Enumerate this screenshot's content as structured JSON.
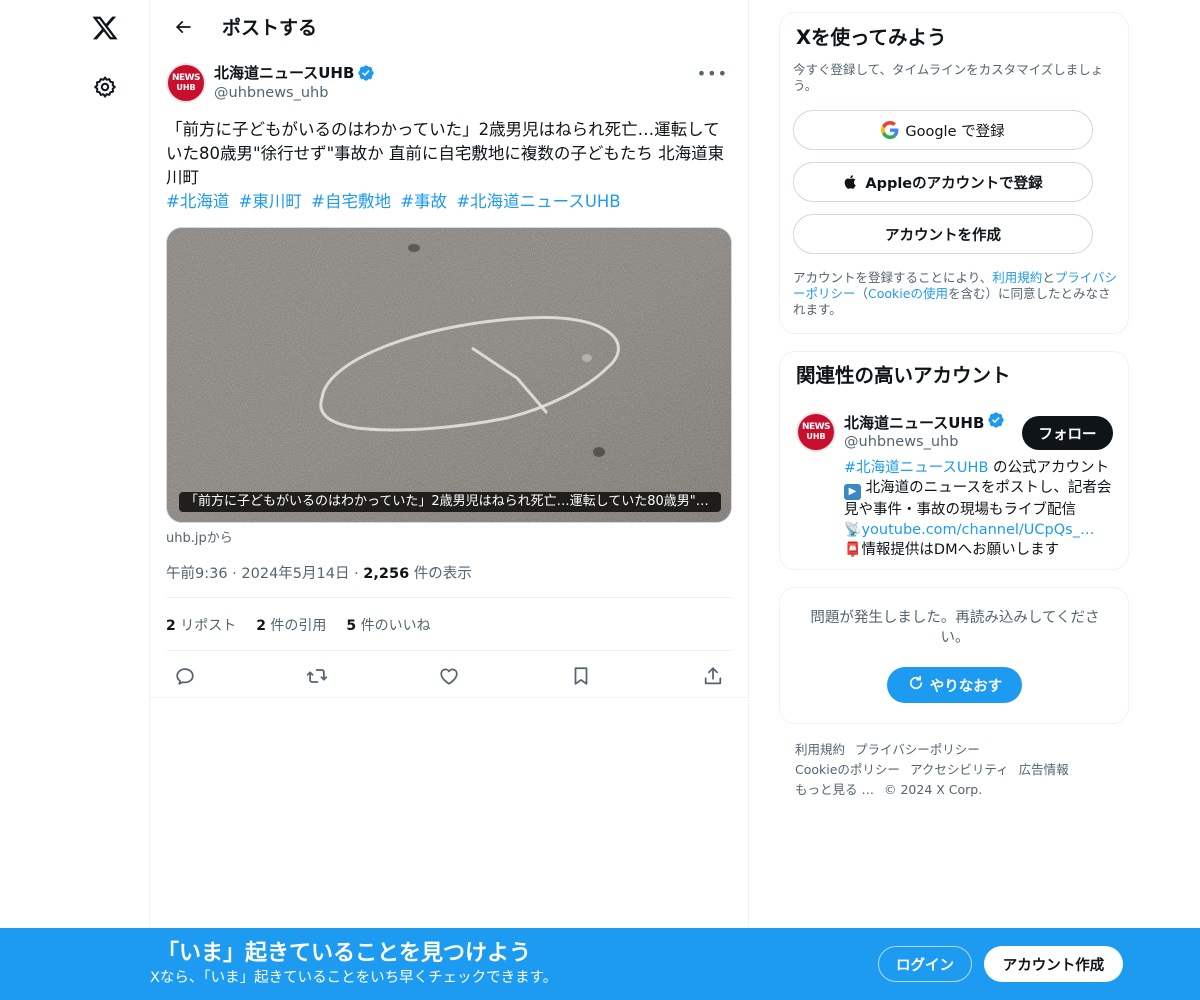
{
  "nav": {
    "logo_icon": "x-logo-icon",
    "settings_icon": "gear-icon"
  },
  "header": {
    "back_icon": "arrow-left-icon",
    "title": "ポストする"
  },
  "post": {
    "author_name": "北海道ニュースUHB",
    "author_handle": "@uhbnews_uhb",
    "avatar_line1": "NEWS",
    "avatar_line2": "UHB",
    "text": "「前方に子どもがいるのはわかっていた」2歳男児はねられ死亡…運転していた80歳男\"徐行せず\"事故か 直前に自宅敷地に複数の子どもたち 北海道東川町",
    "hashtags": [
      "#北海道",
      "#東川町",
      "#自宅敷地",
      "#事故",
      "#北海道ニュースUHB"
    ],
    "media_caption": "「前方に子どもがいるのはわかっていた」2歳男児はねられ死亡…運転していた80歳男\"徐...",
    "source": "uhb.jpから",
    "time": "午前9:36",
    "date": "2024年5月14日",
    "views_count": "2,256",
    "views_label": "件の表示",
    "stats": {
      "reposts_count": "2",
      "reposts_label": "リポスト",
      "quotes_count": "2",
      "quotes_label": "件の引用",
      "likes_count": "5",
      "likes_label": "件のいいね"
    },
    "actions": [
      "reply-icon",
      "repost-icon",
      "like-icon",
      "bookmark-icon",
      "share-icon"
    ]
  },
  "signup_card": {
    "title": "Xを使ってみよう",
    "subtitle": "今すぐ登録して、タイムラインをカスタマイズしましょう。",
    "google_label": "Google で登録",
    "apple_label": "Appleのアカウントで登録",
    "create_label": "アカウントを作成",
    "legal_prefix": "アカウントを登録することにより、",
    "legal_terms": "利用規約",
    "legal_and": "と",
    "legal_privacy": "プライバシーポリシー",
    "legal_open": "（",
    "legal_cookie": "Cookieの使用",
    "legal_suffix": "を含む）に同意したとみなされます。"
  },
  "related": {
    "title": "関連性の高いアカウント",
    "name": "北海道ニュースUHB",
    "handle": "@uhbnews_uhb",
    "follow_label": "フォロー",
    "bio_hashtag": "#北海道ニュースUHB",
    "bio_1": " の公式アカウント",
    "bio_emoji_1": "▶",
    "bio_2": " 北海道のニュースをポストし、記者会見や事件・事故の現場もライブ配信",
    "bio_emoji_2": "📡",
    "bio_link": "youtube.com/channel/UCpQs_…",
    "bio_emoji_3": "📮",
    "bio_3": "情報提供はDMへお願いします"
  },
  "error_card": {
    "text": "問題が発生しました。再読み込みしてください。",
    "retry_label": "やりなおす"
  },
  "footer": {
    "links": [
      "利用規約",
      "プライバシーポリシー",
      "Cookieのポリシー",
      "アクセシビリティ",
      "広告情報",
      "もっと見る …"
    ],
    "copyright": "© 2024 X Corp."
  },
  "banner": {
    "title": "「いま」起きていることを見つけよう",
    "subtitle": "Xなら、「いま」起きていることをいち早くチェックできます。",
    "login_label": "ログイン",
    "signup_label": "アカウント作成"
  },
  "colors": {
    "accent": "#1d9bf0",
    "text": "#0f1419",
    "muted": "#536471",
    "border": "#eff3f4"
  }
}
